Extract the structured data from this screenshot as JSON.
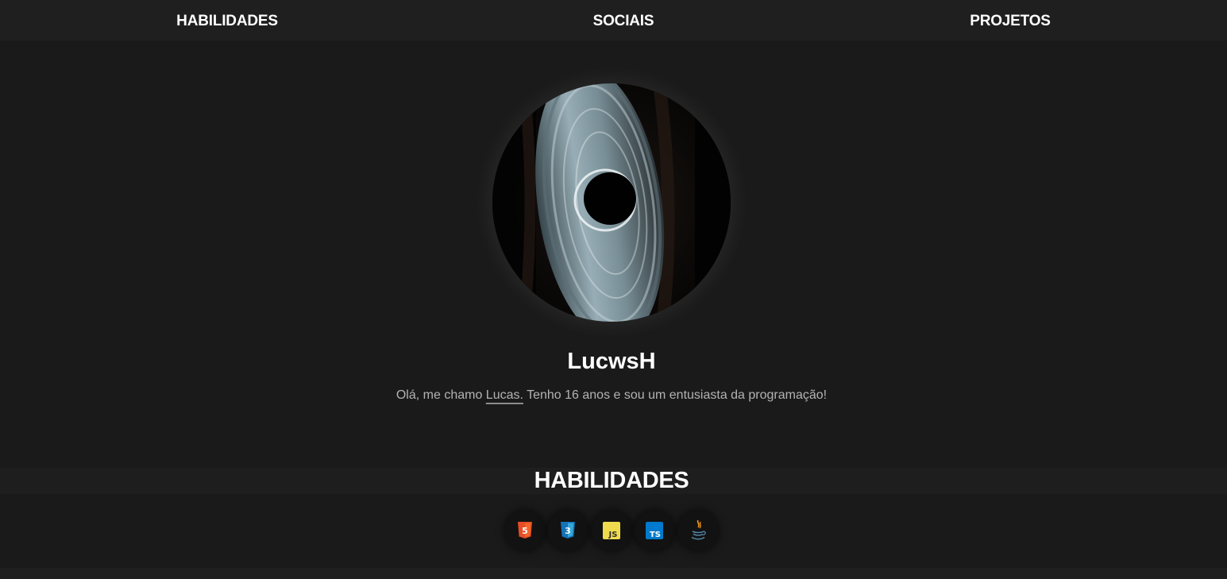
{
  "nav": {
    "links": [
      "HABILIDADES",
      "SOCIAIS",
      "PROJETOS"
    ]
  },
  "profile": {
    "name": "LucwsH",
    "bio_before": "Olá, me chamo ",
    "bio_highlight": "Lucas.",
    "bio_after": " Tenho 16 anos e sou um entusiasta da programação!",
    "avatar_icon": "black-hole-image"
  },
  "skills": {
    "title": "HABILIDADES",
    "items": [
      {
        "icon": "html5-icon",
        "label": "5",
        "color": "#e44d26"
      },
      {
        "icon": "css3-icon",
        "label": "3",
        "color": "#2965f1"
      },
      {
        "icon": "javascript-icon",
        "label": "JS",
        "color": "#f0db4f"
      },
      {
        "icon": "typescript-icon",
        "label": "TS",
        "color": "#007acc"
      },
      {
        "icon": "java-icon",
        "label": "",
        "color": "#f89820"
      }
    ]
  },
  "colors": {
    "background": "#1a1a1a",
    "nav": "#1f1f1f",
    "text": "#ffffff",
    "muted": "#b3b3b3"
  }
}
